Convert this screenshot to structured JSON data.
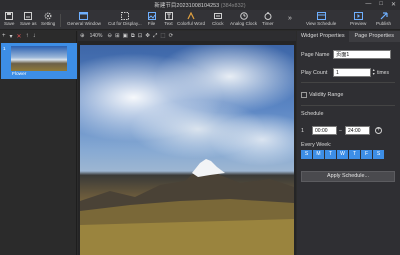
{
  "window": {
    "title": "新建节目20231008104253",
    "title_dim": "(384x832)",
    "min": "—",
    "max": "□",
    "close": "✕"
  },
  "toolbar": {
    "items": [
      {
        "label": "Save",
        "icon": "save-icon"
      },
      {
        "label": "Save as",
        "icon": "save-as-icon"
      },
      {
        "label": "Setting",
        "icon": "gear-icon"
      },
      {
        "label": "General Window",
        "icon": "window-icon"
      },
      {
        "label": "Cut for Display...",
        "icon": "cut-icon"
      },
      {
        "label": "File",
        "icon": "file-icon"
      },
      {
        "label": "Text",
        "icon": "text-icon"
      },
      {
        "label": "Colorful Word",
        "icon": "colorful-word-icon"
      },
      {
        "label": "Clock",
        "icon": "clock-icon"
      },
      {
        "label": "Analog Clock",
        "icon": "analog-clock-icon"
      },
      {
        "label": "Timer",
        "icon": "timer-icon"
      }
    ],
    "more": "»",
    "right_items": [
      {
        "label": "View Schedule",
        "icon": "view-schedule-icon"
      },
      {
        "label": "Preview",
        "icon": "preview-icon"
      },
      {
        "label": "Publish",
        "icon": "publish-icon"
      }
    ]
  },
  "left": {
    "tools": [
      "+",
      "▾",
      "✕",
      "↑",
      "↓"
    ],
    "page_number": "1",
    "thumb_label": "Flower"
  },
  "canvas": {
    "zoom": "140%",
    "tools": [
      "⊕",
      "⊖",
      "⊞",
      "▣",
      "⧉",
      "⊡",
      "✥",
      "⤢",
      "⬚",
      "⟳"
    ]
  },
  "right": {
    "tabs": [
      "Widget Properties",
      "Page Properties"
    ],
    "active_tab": 1,
    "page_name_label": "Page Name",
    "page_name_value": "页面1",
    "play_count_label": "Play Count",
    "play_count_value": "1",
    "times_label": "times",
    "validity_label": "Validity Range",
    "schedule_label": "Schedule",
    "schedule_index": "1",
    "start_time": "00:00",
    "end_time": "24:00",
    "every_week_label": "Every Week:",
    "days": [
      "S",
      "M",
      "T",
      "W",
      "T",
      "F",
      "S"
    ],
    "apply_label": "Apply Schedule..."
  },
  "colors": {
    "accent": "#3d8ee6",
    "background": "#2b2b2b"
  }
}
